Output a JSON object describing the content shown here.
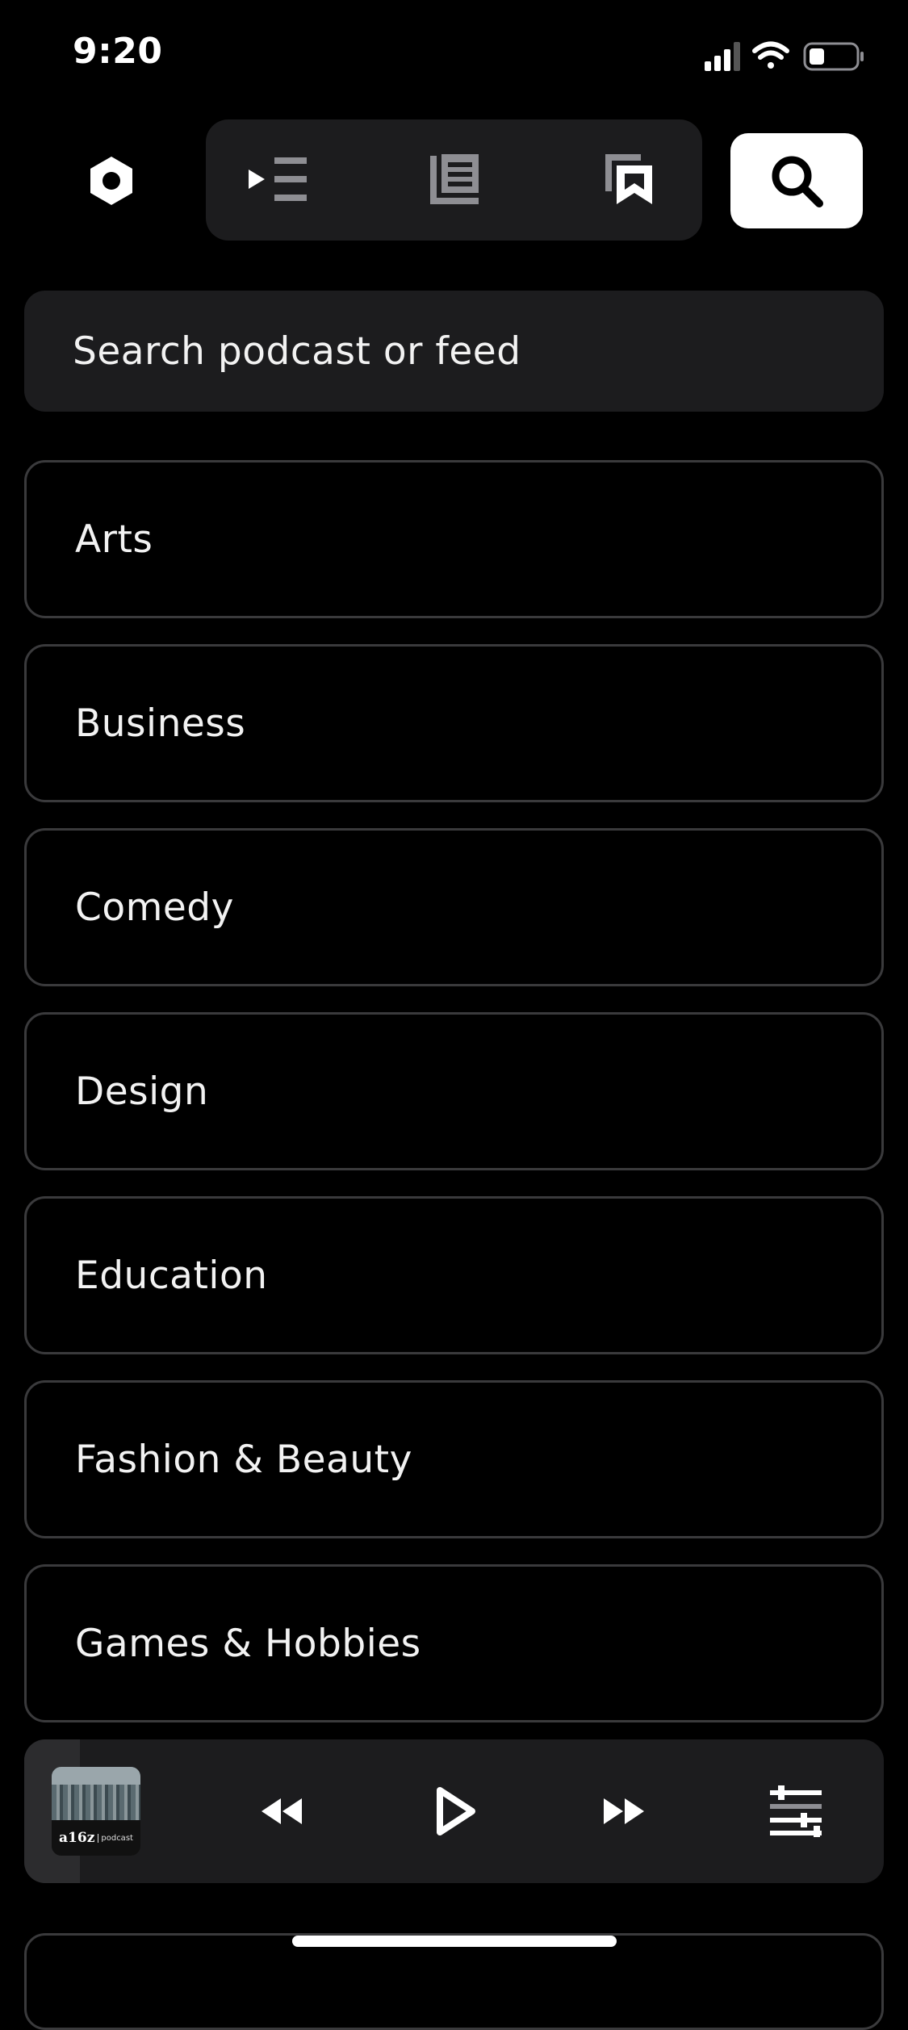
{
  "status_bar": {
    "time": "9:20",
    "icons": [
      "cellular-signal-icon",
      "wifi-icon",
      "battery-icon"
    ]
  },
  "toolbar": {
    "icons": [
      "settings-hexagon-icon",
      "queue-icon",
      "feed-list-icon",
      "bookmarks-icon",
      "search-icon"
    ],
    "active": "search"
  },
  "search": {
    "placeholder": "Search podcast or feed"
  },
  "categories": [
    "Arts",
    "Business",
    "Comedy",
    "Design",
    "Education",
    "Fashion & Beauty",
    "Games & Hobbies"
  ],
  "player": {
    "artwork_brand": "a16z",
    "artwork_sub": "podcast",
    "progress_fraction": 0.065,
    "controls": [
      "rewind-icon",
      "play-icon",
      "fast-forward-icon",
      "equalizer-icon"
    ]
  },
  "colors": {
    "background": "#000000",
    "surface": "#1c1c1e",
    "border": "#3a3a3c",
    "text": "#f2f2f2",
    "accent": "#ffffff"
  }
}
